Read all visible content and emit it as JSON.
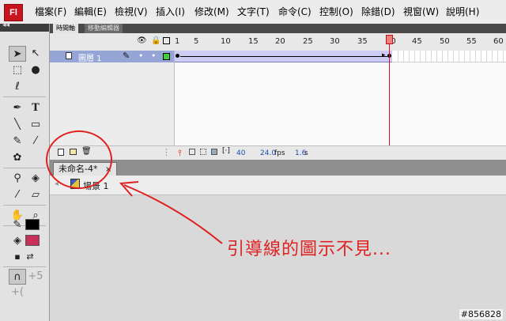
{
  "app": {
    "logo": "Fl"
  },
  "menu": [
    "檔案(F)",
    "編輯(E)",
    "檢視(V)",
    "插入(I)",
    "修改(M)",
    "文字(T)",
    "命令(C)",
    "控制(O)",
    "除錯(D)",
    "視窗(W)",
    "說明(H)"
  ],
  "timeline": {
    "tabs": [
      "時間軸",
      "移動編輯器"
    ],
    "frame_numbers": [
      "1",
      "5",
      "10",
      "15",
      "20",
      "25",
      "30",
      "35",
      "40",
      "45",
      "50",
      "55",
      "60"
    ],
    "layer": {
      "name": "圖層 1"
    },
    "footer": {
      "current_frame": "40",
      "fps": "24.0",
      "fps_unit": "fps",
      "elapsed": "1.6",
      "elapsed_unit": "s"
    }
  },
  "document": {
    "tab_label": "未命名-4*",
    "close": "×",
    "scene": "場景 1"
  },
  "annotation": {
    "text": "引導線的圖示不見..."
  },
  "watermark": "#856828",
  "colors": {
    "stroke": "#000000",
    "fill": "#c8305a",
    "playhead": "#e01010",
    "annotation": "#e02020"
  }
}
